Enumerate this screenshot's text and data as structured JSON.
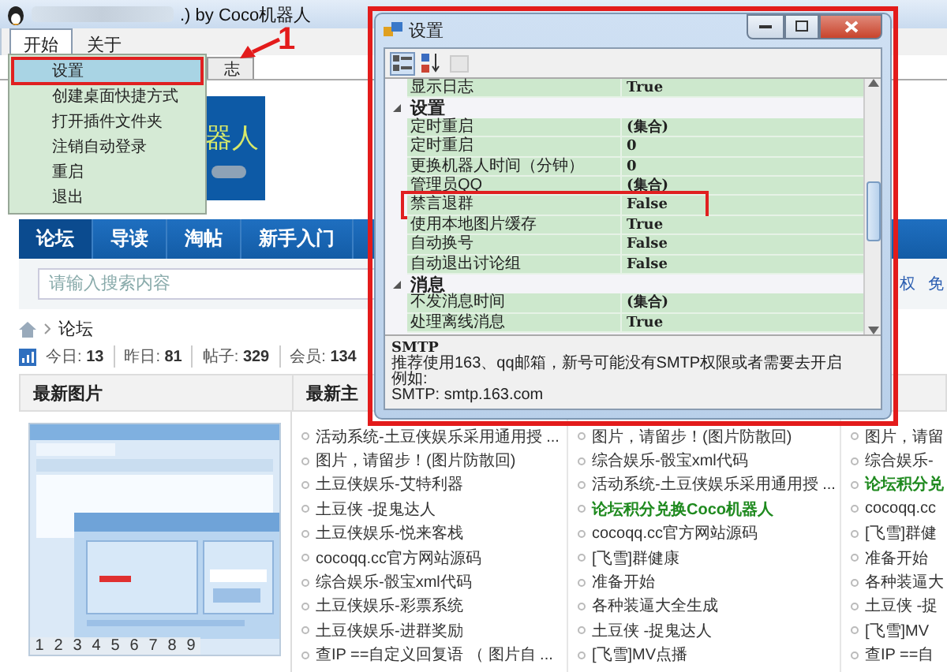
{
  "window": {
    "title": ".) by Coco机器人"
  },
  "menu_bar": [
    {
      "label": "开始",
      "selected": true
    },
    {
      "label": "关于",
      "selected": false
    }
  ],
  "tabs": [
    {
      "label": "志",
      "selected": false
    }
  ],
  "open_menu": {
    "items": [
      {
        "label": "设置",
        "selected": true,
        "annotated": true
      },
      {
        "label": "创建桌面快捷方式",
        "selected": false,
        "annotated": false
      },
      {
        "label": "打开插件文件夹",
        "selected": false,
        "annotated": false
      },
      {
        "label": "注销自动登录",
        "selected": false,
        "annotated": false
      },
      {
        "label": "重启",
        "selected": false,
        "annotated": false
      },
      {
        "label": "退出",
        "selected": false,
        "annotated": false
      }
    ]
  },
  "banner": {
    "logo_text": "器人"
  },
  "nav": [
    {
      "label": "论坛",
      "selected": true
    },
    {
      "label": "导读",
      "selected": false
    },
    {
      "label": "淘帖",
      "selected": false
    },
    {
      "label": "新手入门",
      "selected": false
    }
  ],
  "search": {
    "placeholder": "请输入搜索内容"
  },
  "header_links": [
    "权",
    "免"
  ],
  "breadcrumb": [
    "论坛"
  ],
  "stats": [
    "今日: **13**",
    "昨日: **81**",
    "帖子: **329**",
    "会员: **134**"
  ],
  "sections": [
    {
      "title": "最新图片"
    },
    {
      "title": "最新主"
    }
  ],
  "gallery": {
    "kind": "picture",
    "pages": [
      "1",
      "2",
      "3",
      "4",
      "5",
      "6",
      "7",
      "8",
      "9"
    ]
  },
  "topic_columns": [
    [
      {
        "title": "活动系统-土豆侠娱乐采用通用授 ...",
        "highlight": false
      },
      {
        "title": "图片，请留步！(图片防散回)",
        "highlight": false
      },
      {
        "title": "土豆侠娱乐-艾特利器",
        "highlight": false
      },
      {
        "title": "土豆侠 -捉鬼达人",
        "highlight": false
      },
      {
        "title": "土豆侠娱乐-悦来客栈",
        "highlight": false
      },
      {
        "title": "cocoqq.cc官方网站源码",
        "highlight": false
      },
      {
        "title": "综合娱乐-骰宝xml代码",
        "highlight": false
      },
      {
        "title": "土豆侠娱乐-彩票系统",
        "highlight": false
      },
      {
        "title": "土豆侠娱乐-进群奖励",
        "highlight": false
      },
      {
        "title": "查IP ==自定义回复语 （ 图片自 ...",
        "highlight": false
      }
    ],
    [
      {
        "title": "图片，请留步！(图片防散回)",
        "highlight": false
      },
      {
        "title": "综合娱乐-骰宝xml代码",
        "highlight": false
      },
      {
        "title": "活动系统-土豆侠娱乐采用通用授 ...",
        "highlight": false
      },
      {
        "title": "论坛积分兑换Coco机器人",
        "highlight": true
      },
      {
        "title": "cocoqq.cc官方网站源码",
        "highlight": false
      },
      {
        "title": "[飞雪]群健康",
        "highlight": false
      },
      {
        "title": "准备开始",
        "highlight": false
      },
      {
        "title": "各种装逼大全生成",
        "highlight": false
      },
      {
        "title": "土豆侠 -捉鬼达人",
        "highlight": false
      },
      {
        "title": "[飞雪]MV点播",
        "highlight": false
      }
    ],
    [
      {
        "title": "图片，请留",
        "highlight": false
      },
      {
        "title": "综合娱乐-",
        "highlight": false
      },
      {
        "title": "论坛积分兑",
        "highlight": true
      },
      {
        "title": "cocoqq.cc",
        "highlight": false
      },
      {
        "title": "[飞雪]群健",
        "highlight": false
      },
      {
        "title": "准备开始",
        "highlight": false
      },
      {
        "title": "各种装逼大",
        "highlight": false
      },
      {
        "title": "土豆侠 -捉",
        "highlight": false
      },
      {
        "title": "[飞雪]MV",
        "highlight": false
      },
      {
        "title": "查IP ==自",
        "highlight": false
      }
    ]
  ],
  "settings_dialog": {
    "title": "设置",
    "toolbar": [
      {
        "kind": "categorized",
        "selected": true
      },
      {
        "kind": "alphabetical",
        "selected": false
      },
      {
        "kind": "pages",
        "disabled": true
      }
    ],
    "grid": [
      {
        "kind": "property",
        "name": "显示日志",
        "value": "True",
        "annotated": false
      },
      {
        "kind": "category",
        "name": "设置",
        "expanded": true
      },
      {
        "kind": "property",
        "name": "定时重启",
        "value": "(集合)",
        "annotated": false
      },
      {
        "kind": "property",
        "name": "定时重启",
        "value": "0",
        "annotated": false
      },
      {
        "kind": "property",
        "name": "更换机器人时间（分钟）",
        "value": "0",
        "annotated": false
      },
      {
        "kind": "property",
        "name": "管理员QQ",
        "value": "(集合)",
        "annotated": false
      },
      {
        "kind": "property",
        "name": "禁言退群",
        "value": "False",
        "annotated": true
      },
      {
        "kind": "property",
        "name": "使用本地图片缓存",
        "value": "True",
        "annotated": false
      },
      {
        "kind": "property",
        "name": "自动换号",
        "value": "False",
        "annotated": false
      },
      {
        "kind": "property",
        "name": "自动退出讨论组",
        "value": "False",
        "annotated": false
      },
      {
        "kind": "category",
        "name": "消息",
        "expanded": true
      },
      {
        "kind": "property",
        "name": "不发消息时间",
        "value": "(集合)",
        "annotated": false
      },
      {
        "kind": "property",
        "name": "处理离线消息",
        "value": "True",
        "annotated": false
      }
    ],
    "description": {
      "title": "SMTP",
      "lines": [
        "推荐使用163、qq邮箱，新号可能没有SMTP权限或者需要去开启",
        "例如:",
        "SMTP: smtp.163.com"
      ]
    },
    "annotated": true
  },
  "annotations": [
    {
      "label": "1"
    }
  ]
}
